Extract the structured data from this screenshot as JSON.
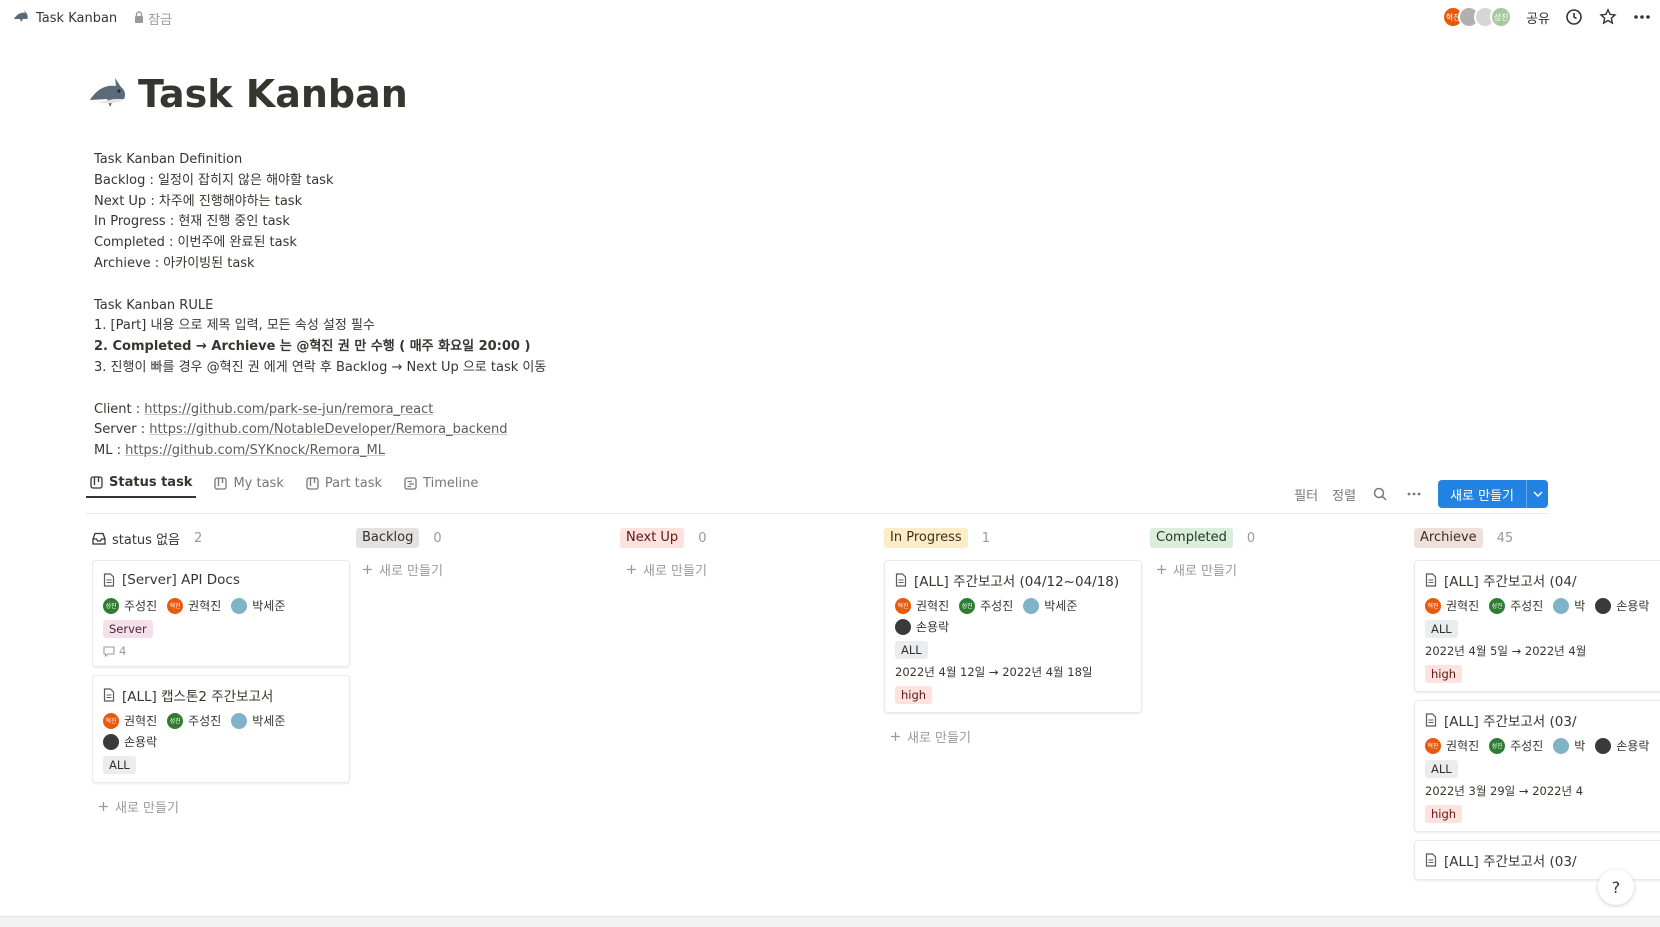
{
  "breadcrumb": {
    "title": "Task Kanban",
    "lock_label": "잠금"
  },
  "topbar": {
    "avatars": [
      {
        "label": "혁진",
        "color": "#e8590c"
      },
      {
        "label": "",
        "color": "#b0b0b0"
      },
      {
        "label": "",
        "color": "#d6d6d6"
      },
      {
        "label": "성진",
        "color": "#a8c9a0"
      }
    ],
    "share_label": "공유",
    "icons": [
      "clock-icon",
      "star-icon",
      "more-icon"
    ]
  },
  "page": {
    "title": "Task Kanban",
    "description": [
      {
        "text": "Task Kanban Definition",
        "bold": false
      },
      {
        "text": "Backlog : 일정이 잡히지 않은 해야할 task",
        "bold": false
      },
      {
        "text": "Next Up : 차주에 진행해야하는 task",
        "bold": false
      },
      {
        "text": "In Progress : 현재 진행 중인 task",
        "bold": false
      },
      {
        "text": "Completed : 이번주에 완료된 task",
        "bold": false
      },
      {
        "text": "Archieve : 아카이빙된 task",
        "bold": false
      },
      {
        "text": "",
        "bold": false
      },
      {
        "text": "Task Kanban RULE",
        "bold": false
      },
      {
        "text": "1. [Part] 내용 으로 제목 입력, 모든 속성 설정 필수",
        "bold": false
      },
      {
        "text": "2. Completed → Archieve 는 @혁진 권 만 수행 ( 매주 화요일 20:00 )",
        "bold": true
      },
      {
        "text": "3. 진행이 빠를 경우 @혁진 권 에게 연락 후 Backlog → Next Up 으로 task 이동",
        "bold": false
      },
      {
        "text": "",
        "bold": false
      }
    ],
    "links": [
      {
        "label": "Client : ",
        "url": "https://github.com/park-se-jun/remora_react"
      },
      {
        "label": "Server : ",
        "url": "https://github.com/NotableDeveloper/Remora_backend"
      },
      {
        "label": "ML : ",
        "url": "https://github.com/SYKnock/Remora_ML"
      }
    ]
  },
  "views": {
    "tabs": [
      "Status task",
      "My task",
      "Part task",
      "Timeline"
    ],
    "active": "Status task",
    "filter_label": "필터",
    "sort_label": "정렬",
    "new_label": "새로 만들기"
  },
  "board": {
    "add_label": "새로 만들기",
    "columns": [
      {
        "name": "status 없음",
        "count": "2",
        "bg": "",
        "fg": "#37352f",
        "cards": [
          {
            "title": "[Server] API Docs",
            "people": [
              {
                "name": "주성진",
                "color": "#2f7d32",
                "init": "성진"
              },
              {
                "name": "권혁진",
                "color": "#e8590c",
                "init": "혁진"
              },
              {
                "name": "박세준",
                "color": "#7fb3c8",
                "init": ""
              }
            ],
            "tags": [
              {
                "text": "Server",
                "bg": "#f5e0e9",
                "fg": "#4c2337"
              }
            ],
            "date": "",
            "priority": "",
            "comments": "4"
          },
          {
            "title": "[ALL] 캡스톤2 주간보고서",
            "people": [
              {
                "name": "권혁진",
                "color": "#e8590c",
                "init": "혁진"
              },
              {
                "name": "주성진",
                "color": "#2f7d32",
                "init": "성진"
              },
              {
                "name": "박세준",
                "color": "#7fb3c8",
                "init": ""
              },
              {
                "name": "손용락",
                "color": "#3a3a3a",
                "init": ""
              }
            ],
            "tags": [
              {
                "text": "ALL",
                "bg": "#ebeced",
                "fg": "#32302c"
              }
            ],
            "date": "",
            "priority": "",
            "comments": ""
          }
        ]
      },
      {
        "name": "Backlog",
        "count": "0",
        "bg": "#e3e2e0",
        "fg": "#32302c",
        "cards": []
      },
      {
        "name": "Next Up",
        "count": "0",
        "bg": "#ffe2dd",
        "fg": "#5d1715",
        "cards": []
      },
      {
        "name": "In Progress",
        "count": "1",
        "bg": "#fdecc8",
        "fg": "#402c1b",
        "cards": [
          {
            "title": "[ALL] 주간보고서 (04/12~04/18)",
            "people": [
              {
                "name": "권혁진",
                "color": "#e8590c",
                "init": "혁진"
              },
              {
                "name": "주성진",
                "color": "#2f7d32",
                "init": "성진"
              },
              {
                "name": "박세준",
                "color": "#7fb3c8",
                "init": ""
              },
              {
                "name": "손용락",
                "color": "#3a3a3a",
                "init": ""
              }
            ],
            "tags": [
              {
                "text": "ALL",
                "bg": "#ebeced",
                "fg": "#32302c"
              }
            ],
            "date": "2022년 4월 12일 → 2022년 4월 18일",
            "priority": "high",
            "comments": ""
          }
        ]
      },
      {
        "name": "Completed",
        "count": "0",
        "bg": "#dbeddb",
        "fg": "#1c3829",
        "cards": []
      },
      {
        "name": "Archieve",
        "count": "45",
        "bg": "#eee0da",
        "fg": "#442a1e",
        "cards": [
          {
            "title": "[ALL] 주간보고서 (04/",
            "people": [
              {
                "name": "권혁진",
                "color": "#e8590c",
                "init": "혁진"
              },
              {
                "name": "주성진",
                "color": "#2f7d32",
                "init": "성진"
              },
              {
                "name": "박",
                "color": "#7fb3c8",
                "init": ""
              },
              {
                "name": "손용락",
                "color": "#3a3a3a",
                "init": ""
              }
            ],
            "tags": [
              {
                "text": "ALL",
                "bg": "#ebeced",
                "fg": "#32302c"
              }
            ],
            "date": "2022년 4월 5일 → 2022년 4월",
            "priority": "high",
            "comments": ""
          },
          {
            "title": "[ALL] 주간보고서 (03/",
            "people": [
              {
                "name": "권혁진",
                "color": "#e8590c",
                "init": "혁진"
              },
              {
                "name": "주성진",
                "color": "#2f7d32",
                "init": "성진"
              },
              {
                "name": "박",
                "color": "#7fb3c8",
                "init": ""
              },
              {
                "name": "손용락",
                "color": "#3a3a3a",
                "init": ""
              }
            ],
            "tags": [
              {
                "text": "ALL",
                "bg": "#ebeced",
                "fg": "#32302c"
              }
            ],
            "date": "2022년 3월 29일 → 2022년 4",
            "priority": "high",
            "comments": ""
          },
          {
            "title": "[ALL] 주간보고서 (03/",
            "people": [],
            "tags": [],
            "date": "",
            "priority": "",
            "comments": ""
          }
        ]
      }
    ]
  },
  "help_label": "?",
  "colors": {
    "accent": "#2383e2",
    "priority_bg": "#ffe2dd",
    "priority_fg": "#5d1715"
  }
}
